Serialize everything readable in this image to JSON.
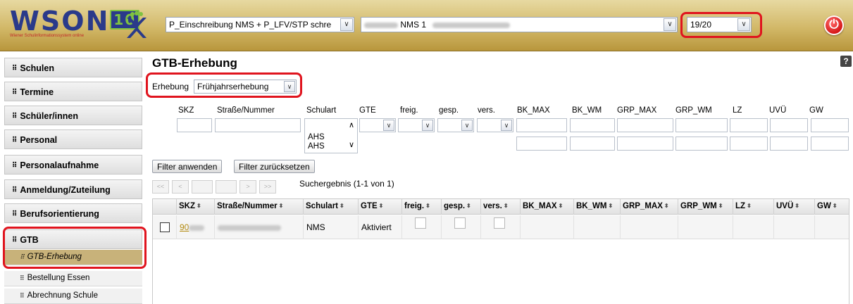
{
  "header": {
    "logo_text": "WSON",
    "logo_ten": "10",
    "logo_subtitle": "Wiener Schulinformationssystem online",
    "program_select": "P_Einschreibung NMS + P_LFV/STP schre",
    "school_select": "NMS 1",
    "year_select": "19/20",
    "power_glyph": "⏻"
  },
  "sidebar": {
    "items": [
      {
        "label": "Schulen"
      },
      {
        "label": "Termine"
      },
      {
        "label": "Schüler/innen"
      },
      {
        "label": "Personal"
      },
      {
        "label": "Personalaufnahme"
      },
      {
        "label": "Anmeldung/Zuteilung"
      },
      {
        "label": "Berufsorientierung"
      },
      {
        "label": "GTB"
      }
    ],
    "subitems": [
      {
        "label": "GTB-Erhebung"
      },
      {
        "label": "Bestellung Essen"
      },
      {
        "label": "Abrechnung Schule"
      }
    ]
  },
  "main": {
    "title": "GTB-Erhebung",
    "help": "?",
    "erhebung_label": "Erhebung",
    "erhebung_value": "Frühjahrserhebung",
    "filter_headers": {
      "skz": "SKZ",
      "strasse": "Straße/Nummer",
      "schulart": "Schulart",
      "gte": "GTE",
      "freig": "freig.",
      "gesp": "gesp.",
      "vers": "vers.",
      "bk_max": "BK_MAX",
      "bk_wm": "BK_WM",
      "grp_max": "GRP_MAX",
      "grp_wm": "GRP_WM",
      "lz": "LZ",
      "uvu": "UVÜ",
      "gw": "GW"
    },
    "schulart_options": [
      "AHS",
      "AHS"
    ],
    "btn_apply": "Filter anwenden",
    "btn_reset": "Filter zurücksetzen",
    "pager": {
      "first": "<<",
      "prev": "<",
      "next": ">",
      "last": ">>"
    },
    "result_text": "Suchergebnis (1-1 von 1)",
    "table": {
      "headers": {
        "skz": "SKZ",
        "strasse": "Straße/Nummer",
        "schulart": "Schulart",
        "gte": "GTE",
        "freig": "freig.",
        "gesp": "gesp.",
        "vers": "vers.",
        "bk_max": "BK_MAX",
        "bk_wm": "BK_WM",
        "grp_max": "GRP_MAX",
        "grp_wm": "GRP_WM",
        "lz": "LZ",
        "uvu": "UVÜ",
        "gw": "GW"
      },
      "sort_glyph": "⬍",
      "row": {
        "skz": "90",
        "schulart": "NMS",
        "gte": "Aktiviert"
      }
    }
  }
}
